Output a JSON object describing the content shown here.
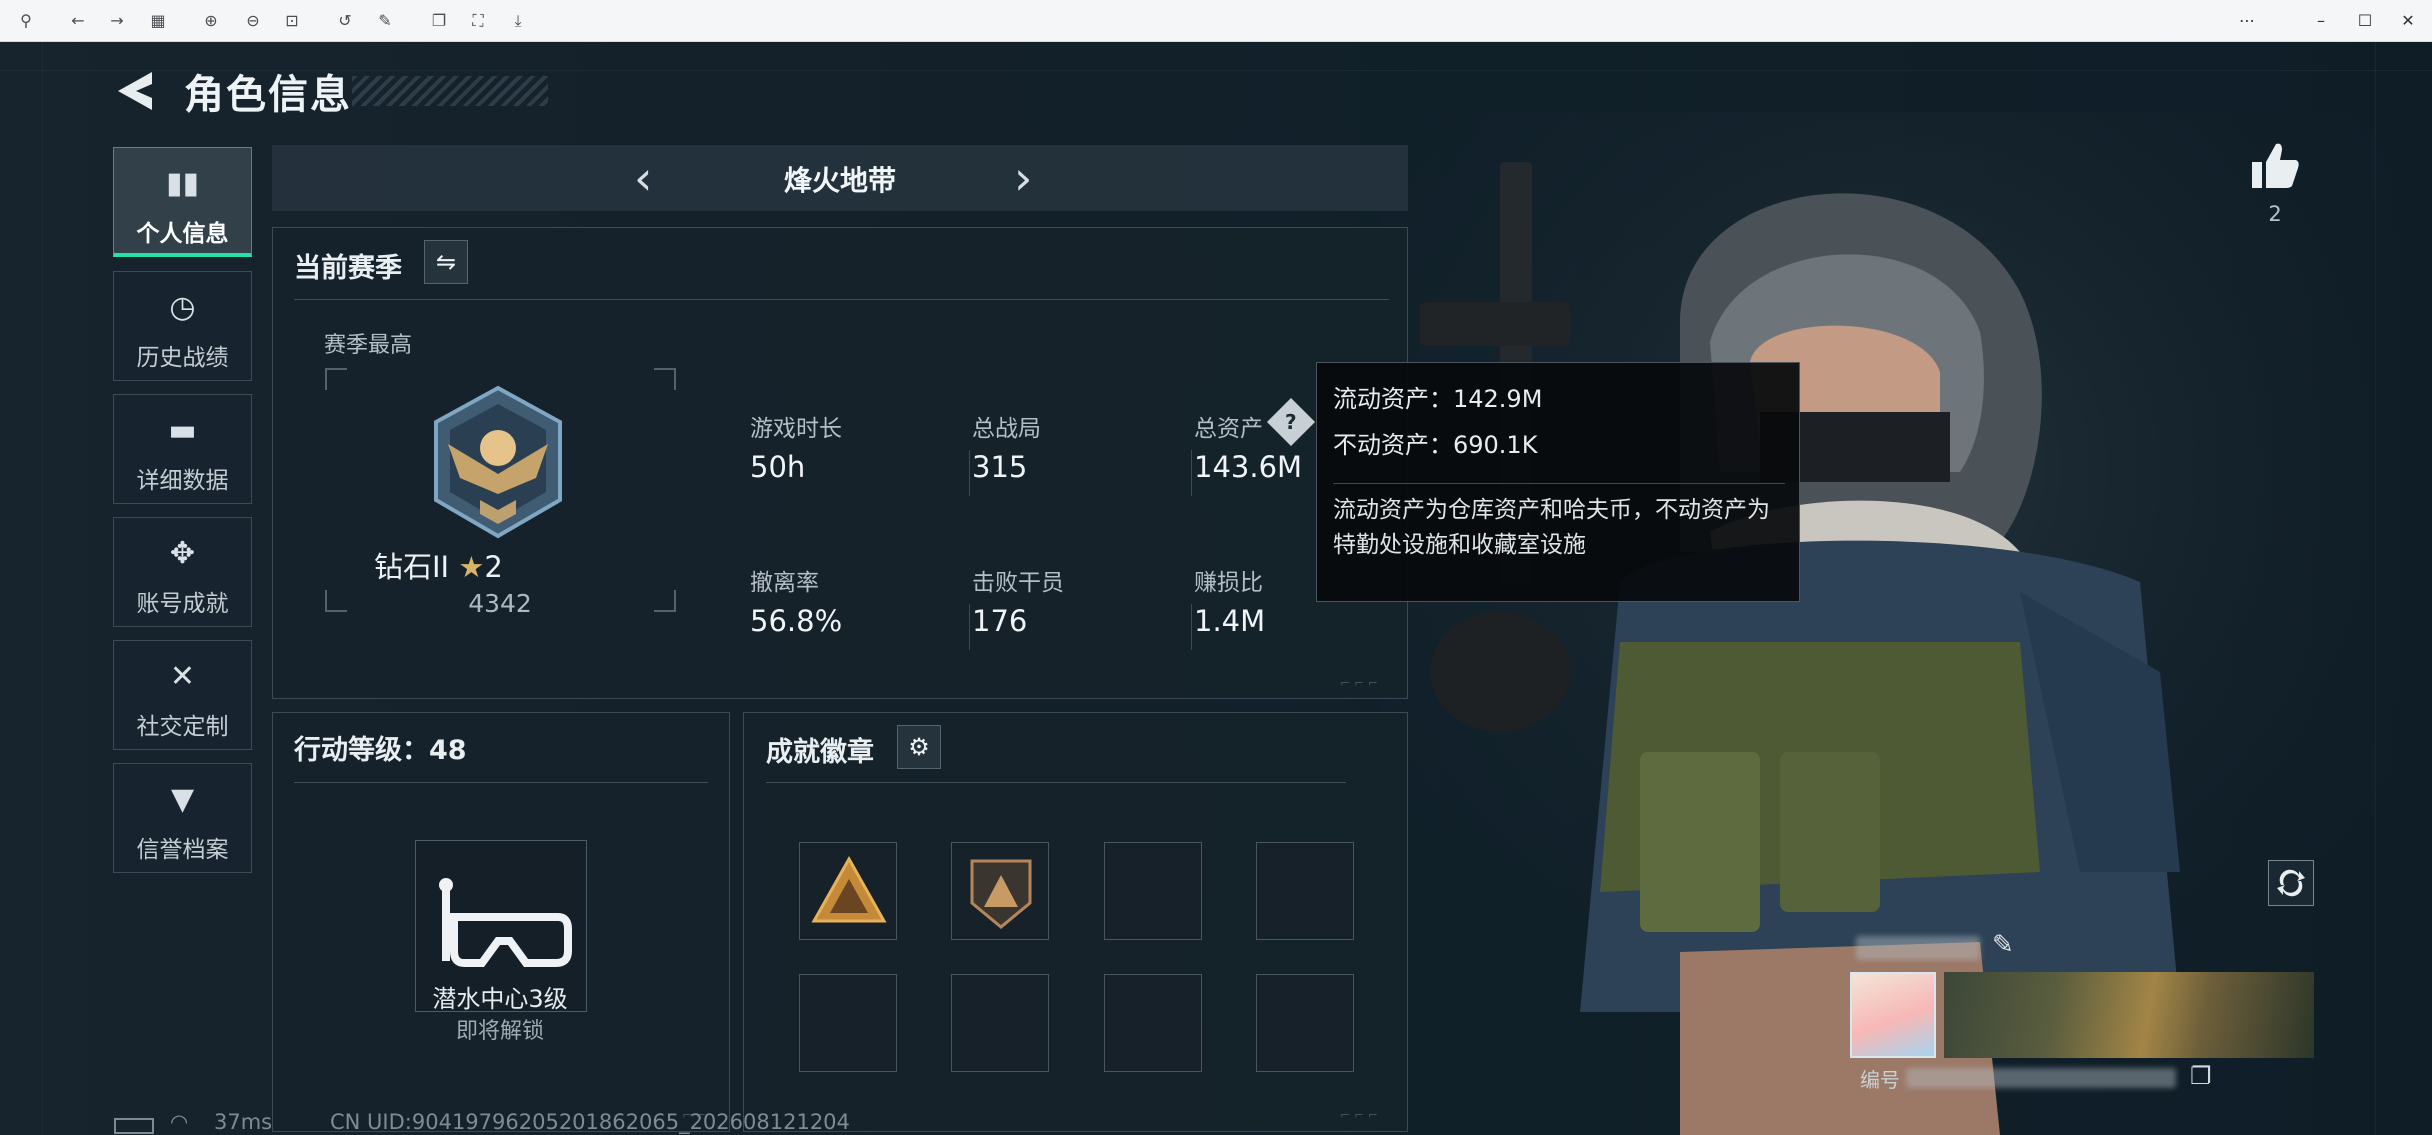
{
  "toolbar": {
    "left_icons": [
      "pin-icon",
      "back-icon",
      "forward-icon",
      "grid-icon",
      "zoom-in-icon",
      "zoom-out-icon",
      "fit-width-icon",
      "rotate-icon",
      "edit-icon",
      "copy-icon",
      "crop-icon",
      "save-icon"
    ],
    "right_icons": [
      "more-icon",
      "minimize-icon",
      "maximize-icon",
      "close-icon"
    ]
  },
  "header": {
    "title": "角色信息"
  },
  "nav": {
    "items": [
      {
        "label": "个人信息",
        "icon": "bar-chart-icon",
        "active": true
      },
      {
        "label": "历史战绩",
        "icon": "clock-icon",
        "active": false
      },
      {
        "label": "详细数据",
        "icon": "folder-icon",
        "active": false
      },
      {
        "label": "账号成就",
        "icon": "medal-icon",
        "active": false
      },
      {
        "label": "社交定制",
        "icon": "tools-icon",
        "active": false
      },
      {
        "label": "信誉档案",
        "icon": "shield-icon",
        "active": false
      }
    ]
  },
  "mode": {
    "title": "烽火地带"
  },
  "season": {
    "title": "当前赛季",
    "best_label": "赛季最高",
    "rank_name": "钻石II",
    "rank_stars": "2",
    "rank_points": "4342",
    "stats": [
      {
        "label": "游戏时长",
        "value": "50h"
      },
      {
        "label": "总战局",
        "value": "315"
      },
      {
        "label": "总资产",
        "value": "143.6M"
      },
      {
        "label": "撤离率",
        "value": "56.8%"
      },
      {
        "label": "击败干员",
        "value": "176"
      },
      {
        "label": "赚损比",
        "value": "1.4M"
      }
    ]
  },
  "tooltip": {
    "liquid": "流动资产：142.9M",
    "fixed": "不动资产：690.1K",
    "description": "流动资产为仓库资产和哈夫币，不动资产为特勤处设施和收藏室设施"
  },
  "action_level": {
    "title": "行动等级：48",
    "unlock_name": "潜水中心3级",
    "unlock_status": "即将解锁"
  },
  "badges": {
    "title": "成就徽章"
  },
  "profile": {
    "likes": "2",
    "name_prefix": "编号"
  },
  "status": {
    "ping": "37ms",
    "uid": "CN UID:9041979620520186​2065_202608121204"
  },
  "colors": {
    "accent": "#27e0a7",
    "gold": "#d8b36a",
    "background": "#13202a"
  }
}
